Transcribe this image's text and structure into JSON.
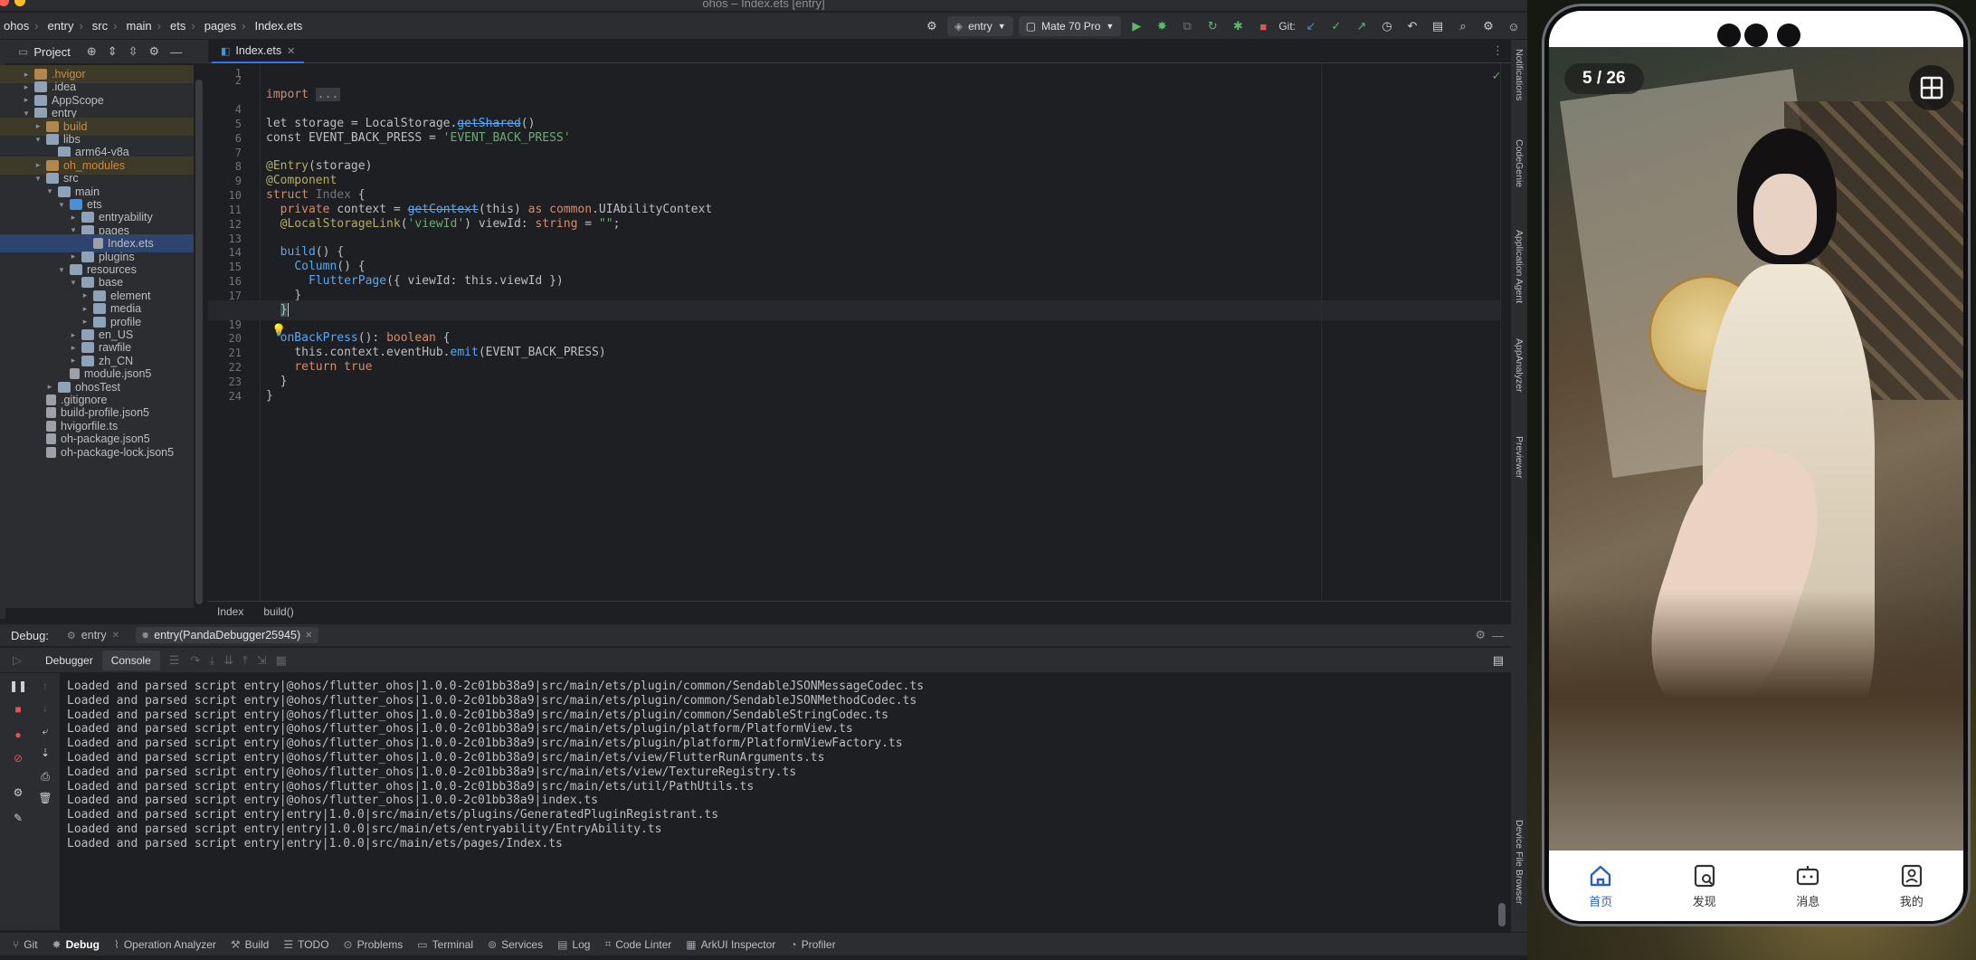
{
  "window": {
    "title": "ohos – Index.ets [entry]"
  },
  "toolbar": {
    "breadcrumbs": [
      "ohos",
      "entry",
      "src",
      "main",
      "ets",
      "pages",
      "Index.ets"
    ],
    "run_config": "entry",
    "device": "Mate 70 Pro",
    "vcs_label": "Git:"
  },
  "project": {
    "header": "Project",
    "tree": [
      {
        "label": ".hvigor",
        "depth": 1,
        "kind": "folder-excluded",
        "arrow": "▸"
      },
      {
        "label": ".idea",
        "depth": 1,
        "kind": "folder",
        "arrow": "▸"
      },
      {
        "label": "AppScope",
        "depth": 1,
        "kind": "folder",
        "arrow": "▸"
      },
      {
        "label": "entry",
        "depth": 1,
        "kind": "folder",
        "arrow": "▾"
      },
      {
        "label": "build",
        "depth": 2,
        "kind": "folder-excluded",
        "arrow": "▸"
      },
      {
        "label": "libs",
        "depth": 2,
        "kind": "folder",
        "arrow": "▾"
      },
      {
        "label": "arm64-v8a",
        "depth": 3,
        "kind": "folder",
        "arrow": ""
      },
      {
        "label": "oh_modules",
        "depth": 2,
        "kind": "folder-excluded",
        "arrow": "▸"
      },
      {
        "label": "src",
        "depth": 2,
        "kind": "folder",
        "arrow": "▾"
      },
      {
        "label": "main",
        "depth": 3,
        "kind": "folder",
        "arrow": "▾"
      },
      {
        "label": "ets",
        "depth": 4,
        "kind": "folder-src",
        "arrow": "▾"
      },
      {
        "label": "entryability",
        "depth": 5,
        "kind": "folder",
        "arrow": "▸"
      },
      {
        "label": "pages",
        "depth": 5,
        "kind": "folder",
        "arrow": "▾"
      },
      {
        "label": "Index.ets",
        "depth": 6,
        "kind": "file",
        "arrow": "",
        "selected": true
      },
      {
        "label": "plugins",
        "depth": 5,
        "kind": "folder",
        "arrow": "▸"
      },
      {
        "label": "resources",
        "depth": 4,
        "kind": "folder",
        "arrow": "▾"
      },
      {
        "label": "base",
        "depth": 5,
        "kind": "folder",
        "arrow": "▾"
      },
      {
        "label": "element",
        "depth": 6,
        "kind": "folder",
        "arrow": "▸"
      },
      {
        "label": "media",
        "depth": 6,
        "kind": "folder",
        "arrow": "▸"
      },
      {
        "label": "profile",
        "depth": 6,
        "kind": "folder",
        "arrow": "▸"
      },
      {
        "label": "en_US",
        "depth": 5,
        "kind": "folder",
        "arrow": "▸"
      },
      {
        "label": "rawfile",
        "depth": 5,
        "kind": "folder",
        "arrow": "▸"
      },
      {
        "label": "zh_CN",
        "depth": 5,
        "kind": "folder",
        "arrow": "▸"
      },
      {
        "label": "module.json5",
        "depth": 4,
        "kind": "file",
        "arrow": ""
      },
      {
        "label": "ohosTest",
        "depth": 3,
        "kind": "folder",
        "arrow": "▸"
      },
      {
        "label": ".gitignore",
        "depth": 2,
        "kind": "file",
        "arrow": ""
      },
      {
        "label": "build-profile.json5",
        "depth": 2,
        "kind": "file",
        "arrow": ""
      },
      {
        "label": "hvigorfile.ts",
        "depth": 2,
        "kind": "file",
        "arrow": ""
      },
      {
        "label": "oh-package.json5",
        "depth": 2,
        "kind": "file",
        "arrow": ""
      },
      {
        "label": "oh-package-lock.json5",
        "depth": 2,
        "kind": "file",
        "arrow": ""
      }
    ]
  },
  "editor": {
    "tab": "Index.ets",
    "current_line": 18,
    "line_numbers": [
      "1",
      "2",
      "4",
      "5",
      "6",
      "7",
      "8",
      "9",
      "10",
      "11",
      "12",
      "13",
      "14",
      "15",
      "16",
      "17",
      "18",
      "19",
      "20",
      "21",
      "22",
      "23",
      "24"
    ],
    "code": {
      "l2": "import",
      "l2_folded": "...",
      "l5_a": "let storage = LocalStorage.",
      "l5_fn": "getShared",
      "l5_b": "()",
      "l6_a": "const EVENT_BACK_PRESS = ",
      "l6_str": "'EVENT_BACK_PRESS'",
      "l8_ann": "@Entry",
      "l8_b": "(storage)",
      "l9_ann": "@Component",
      "l10_kw": "struct",
      "l10_name": "Index",
      "l10_b": "{",
      "l11_kw": "private",
      "l11_a": "context = ",
      "l11_fn": "getContext",
      "l11_b": "(this) ",
      "l11_kw2": "as",
      "l11_type": "common",
      "l11_c": ".UIAbilityContext",
      "l12_ann": "@LocalStorageLink",
      "l12_str": "'viewId'",
      "l12_a": ") viewId: ",
      "l12_type": "string",
      "l12_b": " = ",
      "l12_str2": "\"\"",
      "l12_c": ";",
      "l14_fn": "build",
      "l14_b": "() {",
      "l15_fn": "Column",
      "l15_b": "() {",
      "l16_fn": "FlutterPage",
      "l16_b": "({ viewId: this.viewId })",
      "l17": "}",
      "l18": "}",
      "l20_fn": "onBackPress",
      "l20_b": "(): ",
      "l20_type": "boolean",
      "l20_c": " {",
      "l21_a": "this.context.eventHub.",
      "l21_fn": "emit",
      "l21_b": "(EVENT_BACK_PRESS)",
      "l22_kw": "return",
      "l22_b": " true",
      "l23": "}",
      "l24": "}"
    },
    "structure": [
      "Index",
      "build()"
    ]
  },
  "debug": {
    "label": "Debug:",
    "sessions": [
      "entry",
      "entry(PandaDebugger25945)"
    ],
    "sub_tabs": [
      "Debugger",
      "Console"
    ],
    "console_lines": [
      "Loaded and parsed script entry|@ohos/flutter_ohos|1.0.0-2c01bb38a9|src/main/ets/plugin/common/SendableJSONMessageCodec.ts",
      "Loaded and parsed script entry|@ohos/flutter_ohos|1.0.0-2c01bb38a9|src/main/ets/plugin/common/SendableJSONMethodCodec.ts",
      "Loaded and parsed script entry|@ohos/flutter_ohos|1.0.0-2c01bb38a9|src/main/ets/plugin/common/SendableStringCodec.ts",
      "Loaded and parsed script entry|@ohos/flutter_ohos|1.0.0-2c01bb38a9|src/main/ets/plugin/platform/PlatformView.ts",
      "Loaded and parsed script entry|@ohos/flutter_ohos|1.0.0-2c01bb38a9|src/main/ets/plugin/platform/PlatformViewFactory.ts",
      "Loaded and parsed script entry|@ohos/flutter_ohos|1.0.0-2c01bb38a9|src/main/ets/view/FlutterRunArguments.ts",
      "Loaded and parsed script entry|@ohos/flutter_ohos|1.0.0-2c01bb38a9|src/main/ets/view/TextureRegistry.ts",
      "Loaded and parsed script entry|@ohos/flutter_ohos|1.0.0-2c01bb38a9|src/main/ets/util/PathUtils.ts",
      "Loaded and parsed script entry|@ohos/flutter_ohos|1.0.0-2c01bb38a9|index.ts",
      "Loaded and parsed script entry|entry|1.0.0|src/main/ets/plugins/GeneratedPluginRegistrant.ts",
      "Loaded and parsed script entry|entry|1.0.0|src/main/ets/entryability/EntryAbility.ts",
      "Loaded and parsed script entry|entry|1.0.0|src/main/ets/pages/Index.ts"
    ]
  },
  "bottom_tools": [
    "Git",
    "Debug",
    "Operation Analyzer",
    "Build",
    "TODO",
    "Problems",
    "Terminal",
    "Services",
    "Log",
    "Code Linter",
    "ArkUI Inspector",
    "Profiler"
  ],
  "right_tools": [
    "Notifications",
    "CodeGenie",
    "Application Agent",
    "AppAnalyzer",
    "Previewer",
    "Device File Browser"
  ],
  "phone": {
    "counter": "5 / 26",
    "nav": [
      {
        "label": "首页",
        "icon": "home-icon",
        "active": true
      },
      {
        "label": "发现",
        "icon": "discover-icon",
        "active": false
      },
      {
        "label": "消息",
        "icon": "message-icon",
        "active": false
      },
      {
        "label": "我的",
        "icon": "profile-icon",
        "active": false
      }
    ],
    "accent_color": "#2b5ec9"
  }
}
